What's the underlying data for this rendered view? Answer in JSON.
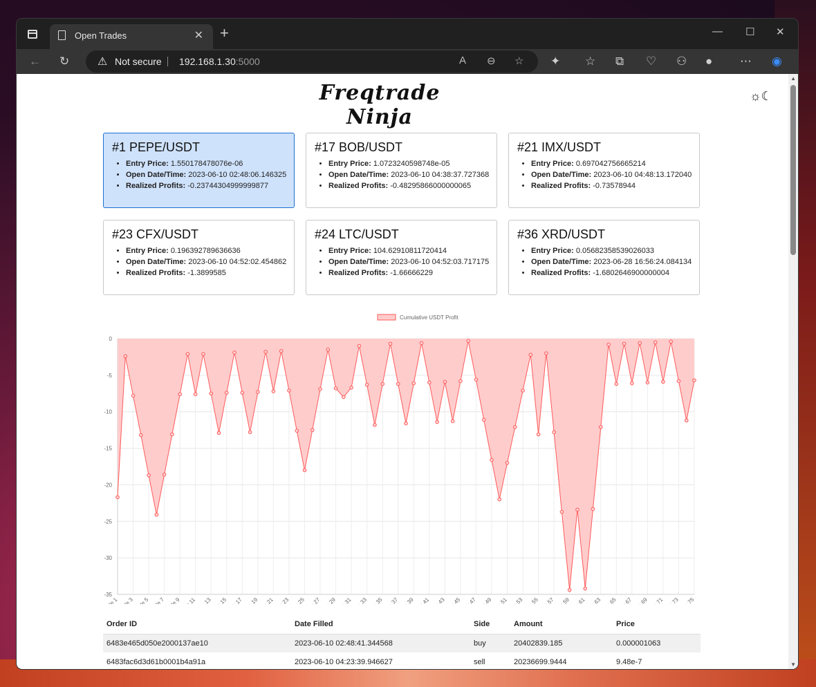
{
  "browser": {
    "tab_title": "Open Trades",
    "security_label": "Not secure",
    "url_host": "192.168.1.30",
    "url_port": ":5000"
  },
  "page": {
    "brand": "Freqtrade Ninja",
    "theme_icons": "☼☾"
  },
  "trades": [
    {
      "title": "#1 PEPE/USDT",
      "entry_price_label": "Entry Price:",
      "entry_price": "1.550178478076e-06",
      "open_label": "Open Date/Time:",
      "open": "2023-06-10 02:48:06.146325",
      "profit_label": "Realized Profits:",
      "profit": "-0.23744304999999877",
      "active": true
    },
    {
      "title": "#17 BOB/USDT",
      "entry_price_label": "Entry Price:",
      "entry_price": "1.0723240598748e-05",
      "open_label": "Open Date/Time:",
      "open": "2023-06-10 04:38:37.727368",
      "profit_label": "Realized Profits:",
      "profit": "-0.48295866000000065",
      "active": false
    },
    {
      "title": "#21 IMX/USDT",
      "entry_price_label": "Entry Price:",
      "entry_price": "0.697042756665214",
      "open_label": "Open Date/Time:",
      "open": "2023-06-10 04:48:13.172040",
      "profit_label": "Realized Profits:",
      "profit": "-0.73578944",
      "active": false
    },
    {
      "title": "#23 CFX/USDT",
      "entry_price_label": "Entry Price:",
      "entry_price": "0.196392789636636",
      "open_label": "Open Date/Time:",
      "open": "2023-06-10 04:52:02.454862",
      "profit_label": "Realized Profits:",
      "profit": "-1.3899585",
      "active": false
    },
    {
      "title": "#24 LTC/USDT",
      "entry_price_label": "Entry Price:",
      "entry_price": "104.62910811720414",
      "open_label": "Open Date/Time:",
      "open": "2023-06-10 04:52:03.717175",
      "profit_label": "Realized Profits:",
      "profit": "-1.66666229",
      "active": false
    },
    {
      "title": "#36 XRD/USDT",
      "entry_price_label": "Entry Price:",
      "entry_price": "0.05682358539026033",
      "open_label": "Open Date/Time:",
      "open": "2023-06-28 16:56:24.084134",
      "profit_label": "Realized Profits:",
      "profit": "-1.6802646900000004",
      "active": false
    }
  ],
  "chart_data": {
    "type": "area",
    "legend": "Cumulative USDT Profit",
    "series_color": "#ff5a5a",
    "fill_color": "#ffcccc",
    "ylim": [
      -35,
      0
    ],
    "yticks": [
      0,
      -5,
      -10,
      -15,
      -20,
      -25,
      -30,
      -35
    ],
    "xtick_labels": [
      "Trade 1",
      "Trade 3",
      "Trade 5",
      "Trade 7",
      "Trade 9",
      "Trade 11",
      "Trade 13",
      "Trade 15",
      "Trade 17",
      "Trade 19",
      "Trade 21",
      "Trade 23",
      "Trade 25",
      "Trade 27",
      "Trade 29",
      "Trade 31",
      "Trade 33",
      "Trade 35",
      "Trade 37",
      "Trade 39",
      "Trade 41",
      "Trade 43",
      "Trade 45",
      "Trade 47",
      "Trade 49",
      "Trade 51",
      "Trade 53",
      "Trade 55",
      "Trade 57",
      "Trade 59",
      "Trade 61",
      "Trade 63",
      "Trade 65",
      "Trade 67",
      "Trade 69",
      "Trade 71",
      "Trade 73",
      "Trade 75"
    ],
    "values": [
      -21.7,
      -2.4,
      -7.8,
      -13.2,
      -18.7,
      -24.1,
      -18.6,
      -13.1,
      -7.6,
      -2.1,
      -7.6,
      -2.1,
      -7.5,
      -12.9,
      -7.4,
      -1.9,
      -7.4,
      -12.8,
      -7.3,
      -1.8,
      -7.2,
      -1.7,
      -7.1,
      -12.6,
      -18.0,
      -12.5,
      -6.9,
      -1.5,
      -6.8,
      -8.0,
      -6.7,
      -1.0,
      -6.3,
      -11.8,
      -6.2,
      -0.7,
      -6.2,
      -11.6,
      -6.1,
      -0.6,
      -6.0,
      -11.4,
      -5.9,
      -11.3,
      -5.8,
      -0.3,
      -5.6,
      -11.1,
      -16.6,
      -22.0,
      -17.0,
      -12.1,
      -7.1,
      -2.2,
      -13.1,
      -2.0,
      -12.8,
      -23.7,
      -34.4,
      -23.4,
      -34.2,
      -23.3,
      -12.1,
      -0.8,
      -6.2,
      -0.7,
      -6.1,
      -0.6,
      -6.0,
      -0.5,
      -5.9,
      -0.4,
      -5.8,
      -11.2,
      -5.7
    ]
  },
  "orders": {
    "headers": [
      "Order ID",
      "Date Filled",
      "Side",
      "Amount",
      "Price"
    ],
    "rows": [
      [
        "6483e465d050e2000137ae10",
        "2023-06-10 02:48:41.344568",
        "buy",
        "20402839.185",
        "0.000001063"
      ],
      [
        "6483fac6d3d61b0001b4a91a",
        "2023-06-10 04:23:39.946627",
        "sell",
        "20236699.9444",
        "9.48e-7"
      ]
    ]
  }
}
